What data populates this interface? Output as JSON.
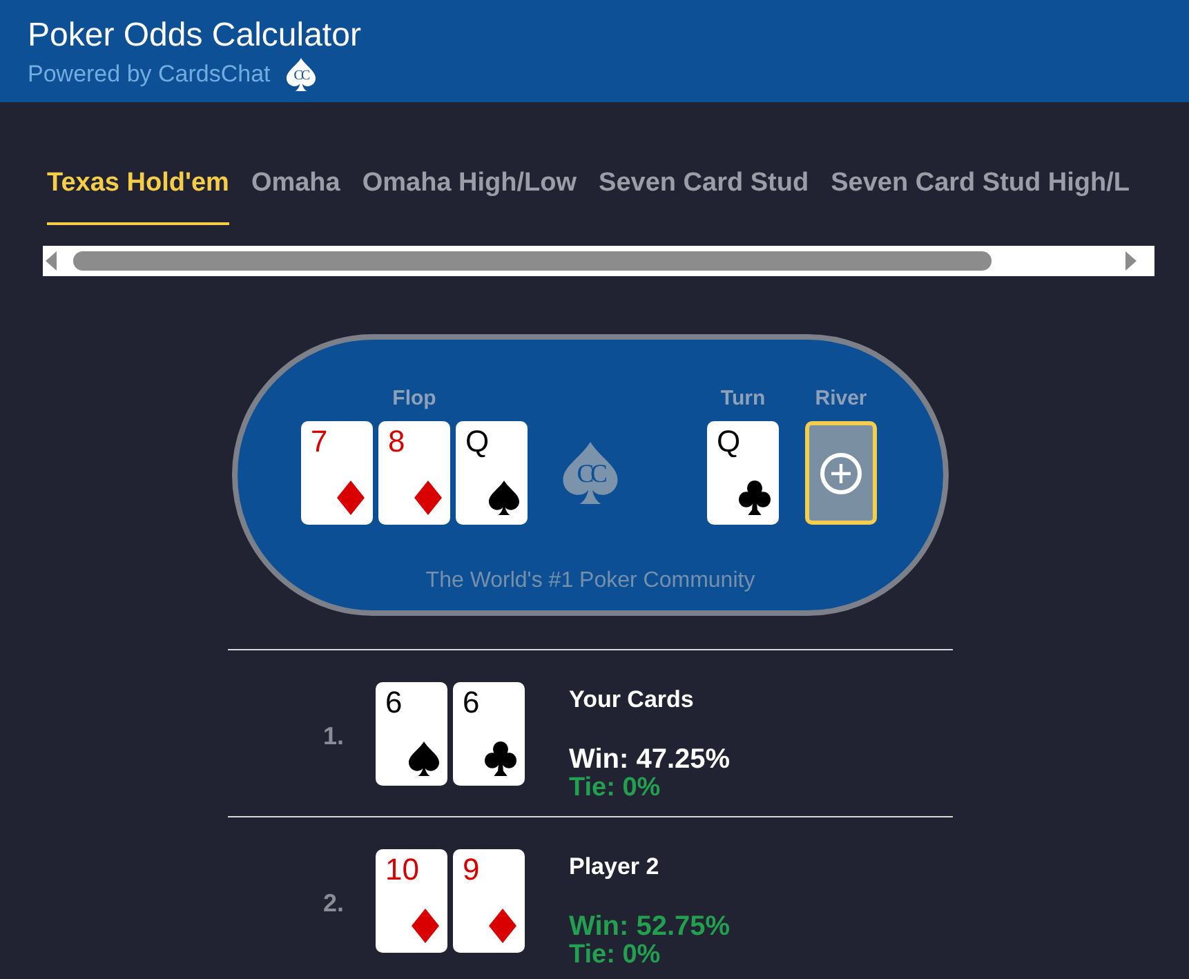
{
  "header": {
    "title": "Poker Odds Calculator",
    "subtitle": "Powered by CardsChat",
    "logo_text": "CC"
  },
  "tabs": [
    {
      "label": "Texas Hold'em",
      "selected": true
    },
    {
      "label": "Omaha",
      "selected": false
    },
    {
      "label": "Omaha High/Low",
      "selected": false
    },
    {
      "label": "Seven Card Stud",
      "selected": false
    },
    {
      "label": "Seven Card Stud High/L",
      "selected": false
    }
  ],
  "table": {
    "logo_text": "CC",
    "board": [
      {
        "label": "Flop",
        "cards": [
          {
            "kind": "diamonds",
            "rank": "7",
            "selected": false
          },
          {
            "kind": "diamonds",
            "rank": "8",
            "selected": false
          },
          {
            "kind": "spades",
            "rank": "Q",
            "selected": false
          }
        ]
      },
      {
        "label": "Turn",
        "cards": [
          {
            "kind": "clubs",
            "rank": "Q",
            "selected": false
          }
        ]
      },
      {
        "label": "River",
        "cards": [
          {
            "kind": "empty",
            "selected": true
          }
        ]
      }
    ],
    "tagline": "The World's #1 Poker Community"
  },
  "players": [
    {
      "number": "1.",
      "name": "Your Cards",
      "cards": [
        {
          "kind": "spades",
          "rank": "6"
        },
        {
          "kind": "clubs",
          "rank": "6"
        }
      ],
      "win": "Win: 47.25%",
      "tie": "Tie: 0%",
      "leading": false
    },
    {
      "number": "2.",
      "name": "Player 2",
      "cards": [
        {
          "kind": "diamonds",
          "rank": "10"
        },
        {
          "kind": "diamonds",
          "rank": "9"
        }
      ],
      "win": "Win: 52.75%",
      "tie": "Tie: 0%",
      "leading": true
    }
  ]
}
